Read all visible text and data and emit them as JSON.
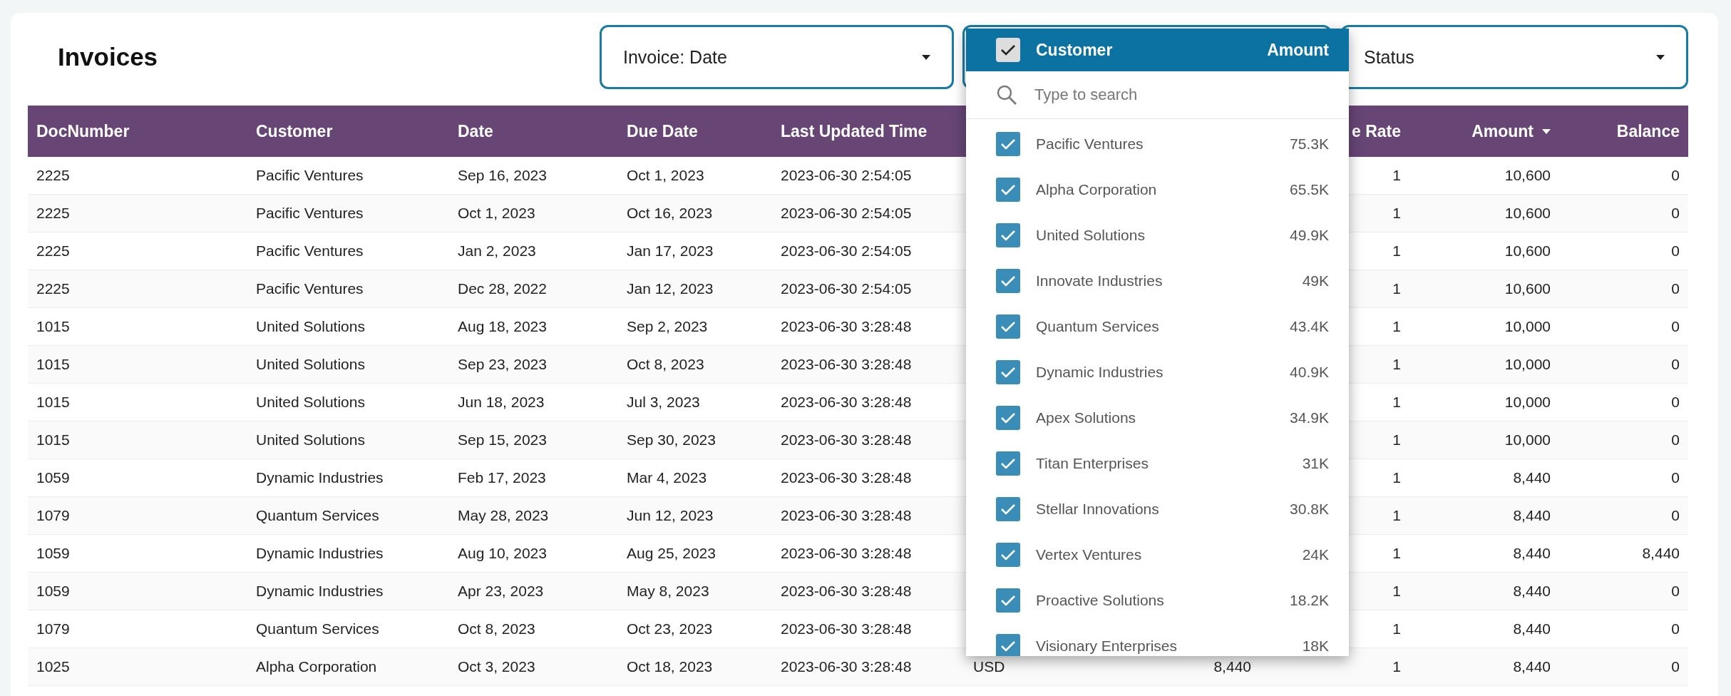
{
  "title": "Invoices",
  "filters": [
    {
      "kind": "select",
      "value": "Invoice: Date"
    },
    {
      "kind": "blank"
    },
    {
      "kind": "select",
      "value": "Status"
    }
  ],
  "table": {
    "columns": [
      {
        "label": "DocNumber",
        "sorted": false
      },
      {
        "label": "Customer",
        "sorted": false
      },
      {
        "label": "Date",
        "sorted": false
      },
      {
        "label": "Due Date",
        "sorted": false
      },
      {
        "label": "Last Updated Time",
        "sorted": false
      },
      {},
      {},
      {
        "label": "e Rate",
        "sorted": false
      },
      {
        "label": "Amount",
        "sorted": true
      },
      {
        "label": "Balance",
        "sorted": false
      }
    ],
    "rows": [
      [
        "2225",
        "Pacific Ventures",
        "Sep 16, 2023",
        "Oct 1, 2023",
        "2023-06-30 2:54:05",
        null,
        null,
        "1",
        "10,600",
        "0"
      ],
      [
        "2225",
        "Pacific Ventures",
        "Oct 1, 2023",
        "Oct 16, 2023",
        "2023-06-30 2:54:05",
        null,
        null,
        "1",
        "10,600",
        "0"
      ],
      [
        "2225",
        "Pacific Ventures",
        "Jan 2, 2023",
        "Jan 17, 2023",
        "2023-06-30 2:54:05",
        null,
        null,
        "1",
        "10,600",
        "0"
      ],
      [
        "2225",
        "Pacific Ventures",
        "Dec 28, 2022",
        "Jan 12, 2023",
        "2023-06-30 2:54:05",
        null,
        null,
        "1",
        "10,600",
        "0"
      ],
      [
        "1015",
        "United Solutions",
        "Aug 18, 2023",
        "Sep 2, 2023",
        "2023-06-30 3:28:48",
        null,
        null,
        "1",
        "10,000",
        "0"
      ],
      [
        "1015",
        "United Solutions",
        "Sep 23, 2023",
        "Oct 8, 2023",
        "2023-06-30 3:28:48",
        null,
        null,
        "1",
        "10,000",
        "0"
      ],
      [
        "1015",
        "United Solutions",
        "Jun 18, 2023",
        "Jul 3, 2023",
        "2023-06-30 3:28:48",
        null,
        null,
        "1",
        "10,000",
        "0"
      ],
      [
        "1015",
        "United Solutions",
        "Sep 15, 2023",
        "Sep 30, 2023",
        "2023-06-30 3:28:48",
        null,
        null,
        "1",
        "10,000",
        "0"
      ],
      [
        "1059",
        "Dynamic Industries",
        "Feb 17, 2023",
        "Mar 4, 2023",
        "2023-06-30 3:28:48",
        null,
        null,
        "1",
        "8,440",
        "0"
      ],
      [
        "1079",
        "Quantum Services",
        "May 28, 2023",
        "Jun 12, 2023",
        "2023-06-30 3:28:48",
        null,
        null,
        "1",
        "8,440",
        "0"
      ],
      [
        "1059",
        "Dynamic Industries",
        "Aug 10, 2023",
        "Aug 25, 2023",
        "2023-06-30 3:28:48",
        null,
        null,
        "1",
        "8,440",
        "8,440"
      ],
      [
        "1059",
        "Dynamic Industries",
        "Apr 23, 2023",
        "May 8, 2023",
        "2023-06-30 3:28:48",
        null,
        null,
        "1",
        "8,440",
        "0"
      ],
      [
        "1079",
        "Quantum Services",
        "Oct 8, 2023",
        "Oct 23, 2023",
        "2023-06-30 3:28:48",
        null,
        null,
        "1",
        "8,440",
        "0"
      ],
      [
        "1025",
        "Alpha Corporation",
        "Oct 3, 2023",
        "Oct 18, 2023",
        "2023-06-30 3:28:48",
        "USD",
        "8,440",
        "1",
        "8,440",
        "0"
      ]
    ]
  },
  "customer_dropdown": {
    "select_all_checked": true,
    "header_label": "Customer",
    "header_amount": "Amount",
    "search": {
      "placeholder": "Type to search"
    },
    "items": [
      {
        "name": "Pacific Ventures",
        "amount": "75.3K",
        "checked": true
      },
      {
        "name": "Alpha Corporation",
        "amount": "65.5K",
        "checked": true
      },
      {
        "name": "United Solutions",
        "amount": "49.9K",
        "checked": true
      },
      {
        "name": "Innovate Industries",
        "amount": "49K",
        "checked": true
      },
      {
        "name": "Quantum Services",
        "amount": "43.4K",
        "checked": true
      },
      {
        "name": "Dynamic Industries",
        "amount": "40.9K",
        "checked": true
      },
      {
        "name": "Apex Solutions",
        "amount": "34.9K",
        "checked": true
      },
      {
        "name": "Titan Enterprises",
        "amount": "31K",
        "checked": true
      },
      {
        "name": "Stellar Innovations",
        "amount": "30.8K",
        "checked": true
      },
      {
        "name": "Vertex Ventures",
        "amount": "24K",
        "checked": true
      },
      {
        "name": "Proactive Solutions",
        "amount": "18.2K",
        "checked": true
      },
      {
        "name": "Visionary Enterprises",
        "amount": "18K",
        "checked": true
      }
    ]
  }
}
